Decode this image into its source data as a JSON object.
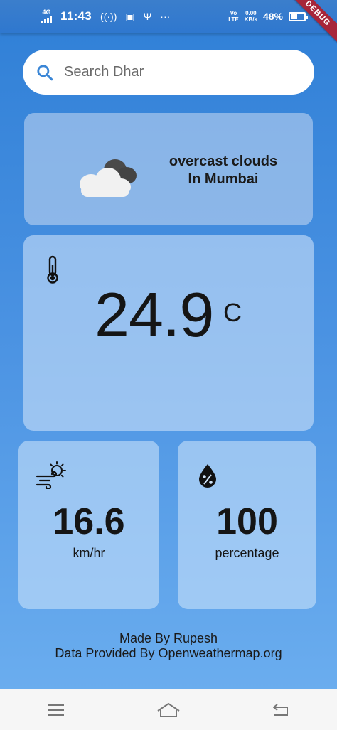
{
  "status_bar": {
    "network_type": "4G",
    "time": "11:43",
    "volte_top": "Vo",
    "volte_bottom": "LTE",
    "speed_value": "0.00",
    "speed_unit": "KB/s",
    "battery_percent": "48%",
    "battery_level": 0.48
  },
  "debug_banner": "DEBUG",
  "search": {
    "placeholder": "Search Dhar"
  },
  "weather": {
    "condition": "overcast clouds",
    "location": "In Mumbai",
    "temperature": "24.9",
    "temperature_unit": "C",
    "wind_speed": "16.6",
    "wind_unit": "km/hr",
    "humidity": "100",
    "humidity_unit": "percentage"
  },
  "footer": {
    "credit": "Made By Rupesh",
    "provider": "Data Provided By Openweathermap.org"
  },
  "icons": {
    "search": "search-icon",
    "condition": "cloud-icon",
    "temperature": "thermometer-icon",
    "wind": "wind-icon",
    "humidity": "humidity-drop-icon",
    "nav_menu": "menu-icon",
    "nav_home": "home-icon",
    "nav_back": "back-icon"
  },
  "colors": {
    "accent": "#2f7fd6",
    "search_icon": "#3a86d6",
    "debug_ribbon": "#a7263a"
  }
}
